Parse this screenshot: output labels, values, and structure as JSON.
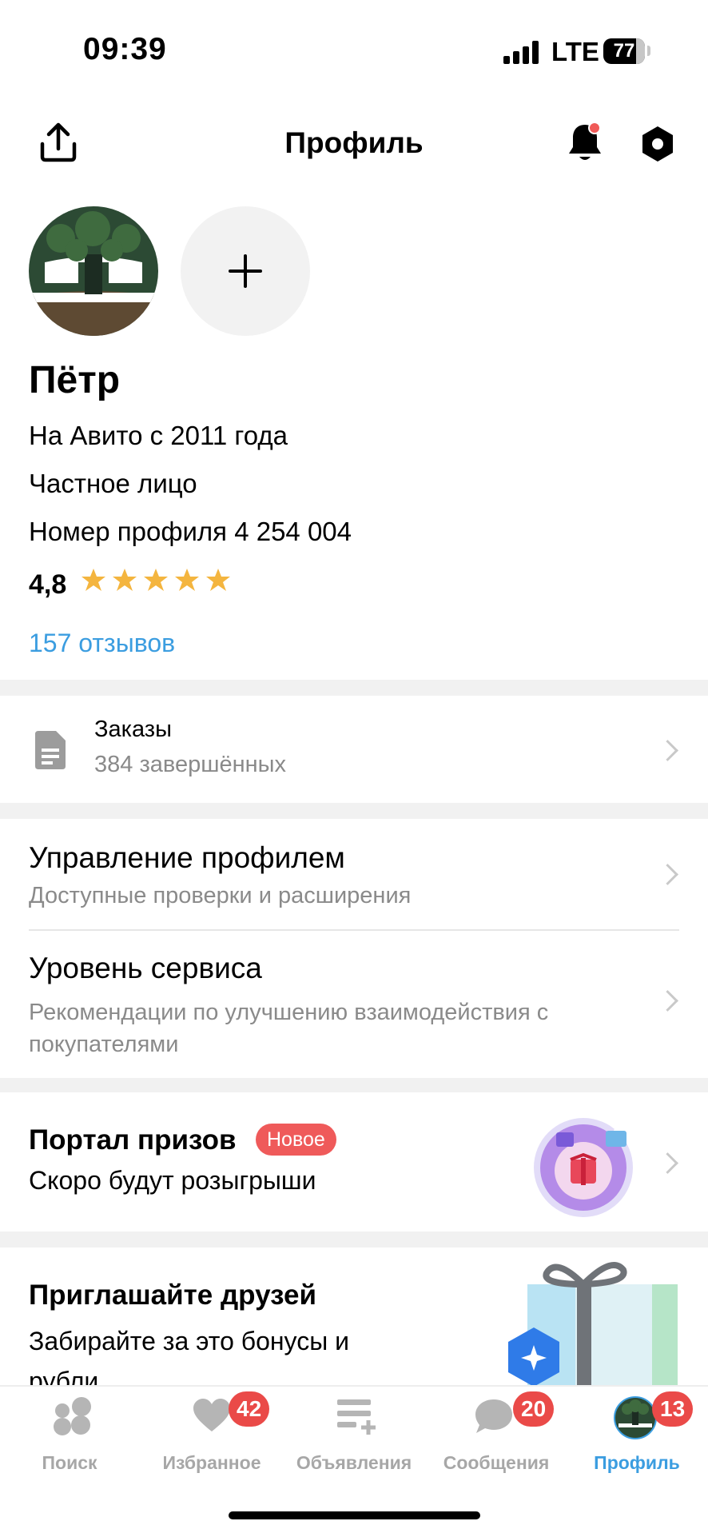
{
  "status_bar": {
    "time": "09:39",
    "network": "LTE",
    "battery": "77"
  },
  "header": {
    "title": "Профиль",
    "icons": [
      "share-icon",
      "bell-icon",
      "settings-icon"
    ]
  },
  "profile": {
    "name": "Пётр",
    "since": "На Авито с 2011 года",
    "type": "Частное лицо",
    "profile_number": "Номер профиля 4 254 004",
    "rating": "4,8",
    "rating_stars": 5,
    "reviews": "157 отзывов"
  },
  "orders": {
    "title": "Заказы",
    "subtitle": "384 завершённых"
  },
  "menu": [
    {
      "title": "Управление профилем",
      "subtitle": "Доступные проверки и расширения"
    },
    {
      "title": "Уровень сервиса",
      "subtitle": "Рекомендации по улучшению взаимодействия с покупателями"
    }
  ],
  "prizes": {
    "title": "Портал призов",
    "badge": "Новое",
    "subtitle": "Скоро будут розыгрыши"
  },
  "invite": {
    "title": "Приглашайте друзей",
    "subtitle": "Забирайте за это бонусы и рубли"
  },
  "tabs": [
    {
      "label": "Поиск",
      "count": ""
    },
    {
      "label": "Избранное",
      "count": "42"
    },
    {
      "label": "Объявления",
      "count": ""
    },
    {
      "label": "Сообщения",
      "count": "20"
    },
    {
      "label": "Профиль",
      "count": "13"
    }
  ],
  "colors": {
    "accent": "#3b9de0",
    "badge_red": "#ea4a48",
    "star": "#f4b53f",
    "new_badge": "#ef5a5a"
  }
}
